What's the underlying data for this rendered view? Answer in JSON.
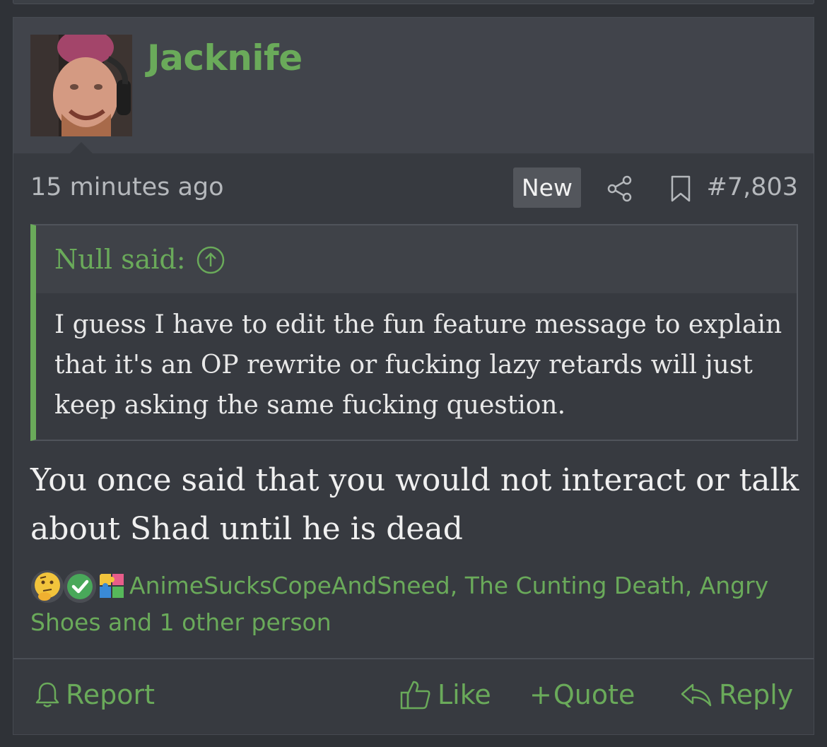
{
  "post": {
    "username": "Jacknife",
    "timestamp": "15 minutes ago",
    "badge": "New",
    "post_number": "#7,803",
    "icons": {
      "share": "share-icon",
      "bookmark": "bookmark-icon"
    }
  },
  "quote": {
    "author": "Null said:",
    "jump_icon": "arrow-up-circle-icon",
    "body": "I guess I have to edit the fun feature message to explain that it's an OP rewrite or fucking lazy retards will just keep asking the same fucking question."
  },
  "message": {
    "body": "You once said that you would not interact or talk about Shad until he is dead"
  },
  "reactions": {
    "icons": [
      "thinking-emoji-icon",
      "checkmark-icon",
      "puzzle-icon"
    ],
    "names": "AnimeSucksCopeAndSneed, The Cunting Death, Angry Shoes and 1 other person"
  },
  "actions": {
    "report": "Report",
    "like": "Like",
    "quote": "Quote",
    "quote_prefix": "+",
    "reply": "Reply"
  },
  "colors": {
    "accent": "#6aaa5a",
    "background": "#2f3237",
    "panel": "#373a40",
    "header": "#41444b"
  }
}
